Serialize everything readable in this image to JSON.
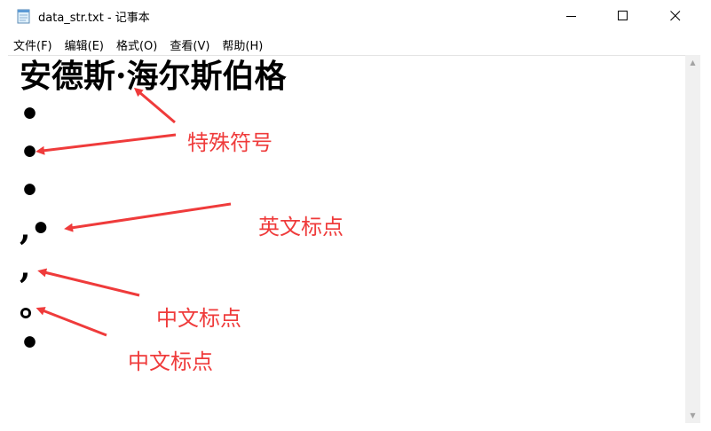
{
  "window": {
    "title": "data_str.txt - 记事本"
  },
  "menu": {
    "items": [
      "文件(F)",
      "编辑(E)",
      "格式(O)",
      "查看(V)",
      "帮助(H)"
    ]
  },
  "editor": {
    "lines": [
      "安德斯·海尔斯伯格",
      "•",
      "•",
      "•",
      ",•",
      ",",
      "。",
      "•"
    ]
  },
  "annotations": {
    "labels": [
      "特殊符号",
      "英文标点",
      "中文标点",
      "中文标点"
    ],
    "color": "#ef3b3b"
  }
}
